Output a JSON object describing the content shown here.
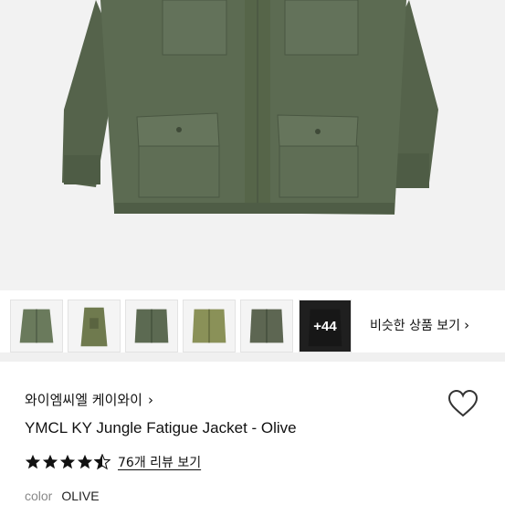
{
  "hero": {
    "colors": {
      "background": "#f3f3f3",
      "jacket": "#5c6b52",
      "jacket_shadow": "#4a5742",
      "jacket_light": "#6c7b61"
    }
  },
  "thumbnails": [
    {
      "color": "#6a7a5c"
    },
    {
      "color": "#6f7a4e"
    },
    {
      "color": "#5c6a52"
    },
    {
      "color": "#8a9158"
    },
    {
      "color": "#5d6652"
    },
    {
      "color": "#2b2b2b",
      "overlay": "+44"
    }
  ],
  "similar_link": {
    "label": "비슷한 상품 보기",
    "icon": "chevron-right-icon"
  },
  "product": {
    "brand": "와이엠씨엘 케이와이",
    "brand_icon": "chevron-right-icon",
    "title": "YMCL KY Jungle Fatigue Jacket - Olive",
    "rating": 4.5,
    "reviews_label": "76개 리뷰 보기",
    "color_label": "color",
    "color_value": "OLIVE",
    "favorite_icon": "heart-outline-icon"
  }
}
